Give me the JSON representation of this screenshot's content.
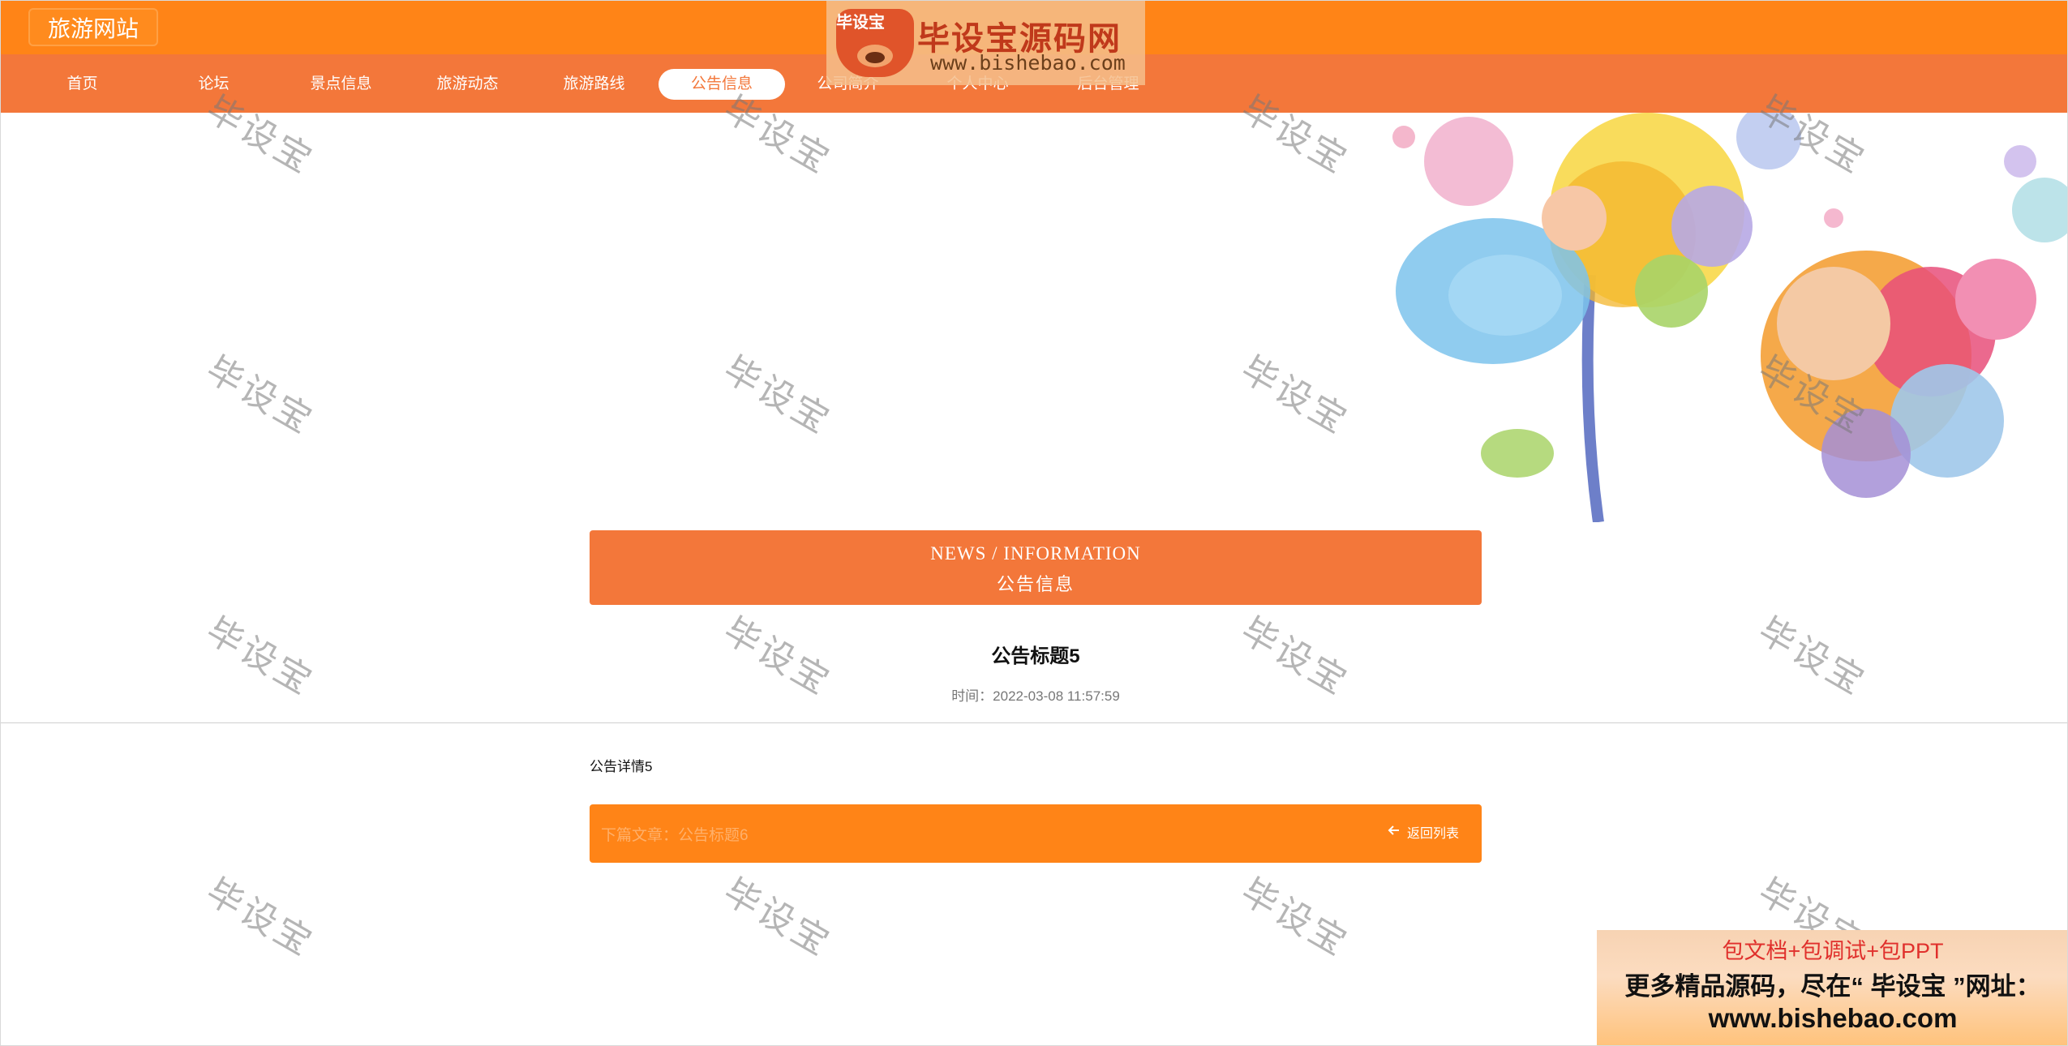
{
  "header": {
    "site_title": "旅游网站"
  },
  "nav": {
    "items": [
      {
        "label": "首页"
      },
      {
        "label": "论坛"
      },
      {
        "label": "景点信息"
      },
      {
        "label": "旅游动态"
      },
      {
        "label": "旅游路线"
      },
      {
        "label": "公告信息"
      },
      {
        "label": "公司简介"
      },
      {
        "label": "个人中心"
      },
      {
        "label": "后台管理"
      }
    ],
    "active_index": 5
  },
  "logo": {
    "badge": "毕设宝",
    "main": "毕设宝源码网",
    "url": "www.bishebao.com"
  },
  "carousel": {
    "slide_count": 3,
    "active_slide": 0
  },
  "section": {
    "title_en": "NEWS / INFORMATION",
    "title_cn": "公告信息"
  },
  "article": {
    "title": "公告标题5",
    "time": "时间：2022-03-08 11:57:59",
    "body": "公告详情5"
  },
  "footer_nav": {
    "next_label": "下篇文章：公告标题6",
    "back_label": "返回列表"
  },
  "watermark": {
    "text": "毕设宝"
  },
  "ad": {
    "line1": "包文档+包调试+包PPT",
    "line2": "更多精品源码，尽在“ 毕设宝 ”网址：",
    "line3": "www.bishebao.com"
  },
  "colors": {
    "header_orange": "#ff8417",
    "nav_orange": "#f3773a",
    "white": "#ffffff"
  }
}
